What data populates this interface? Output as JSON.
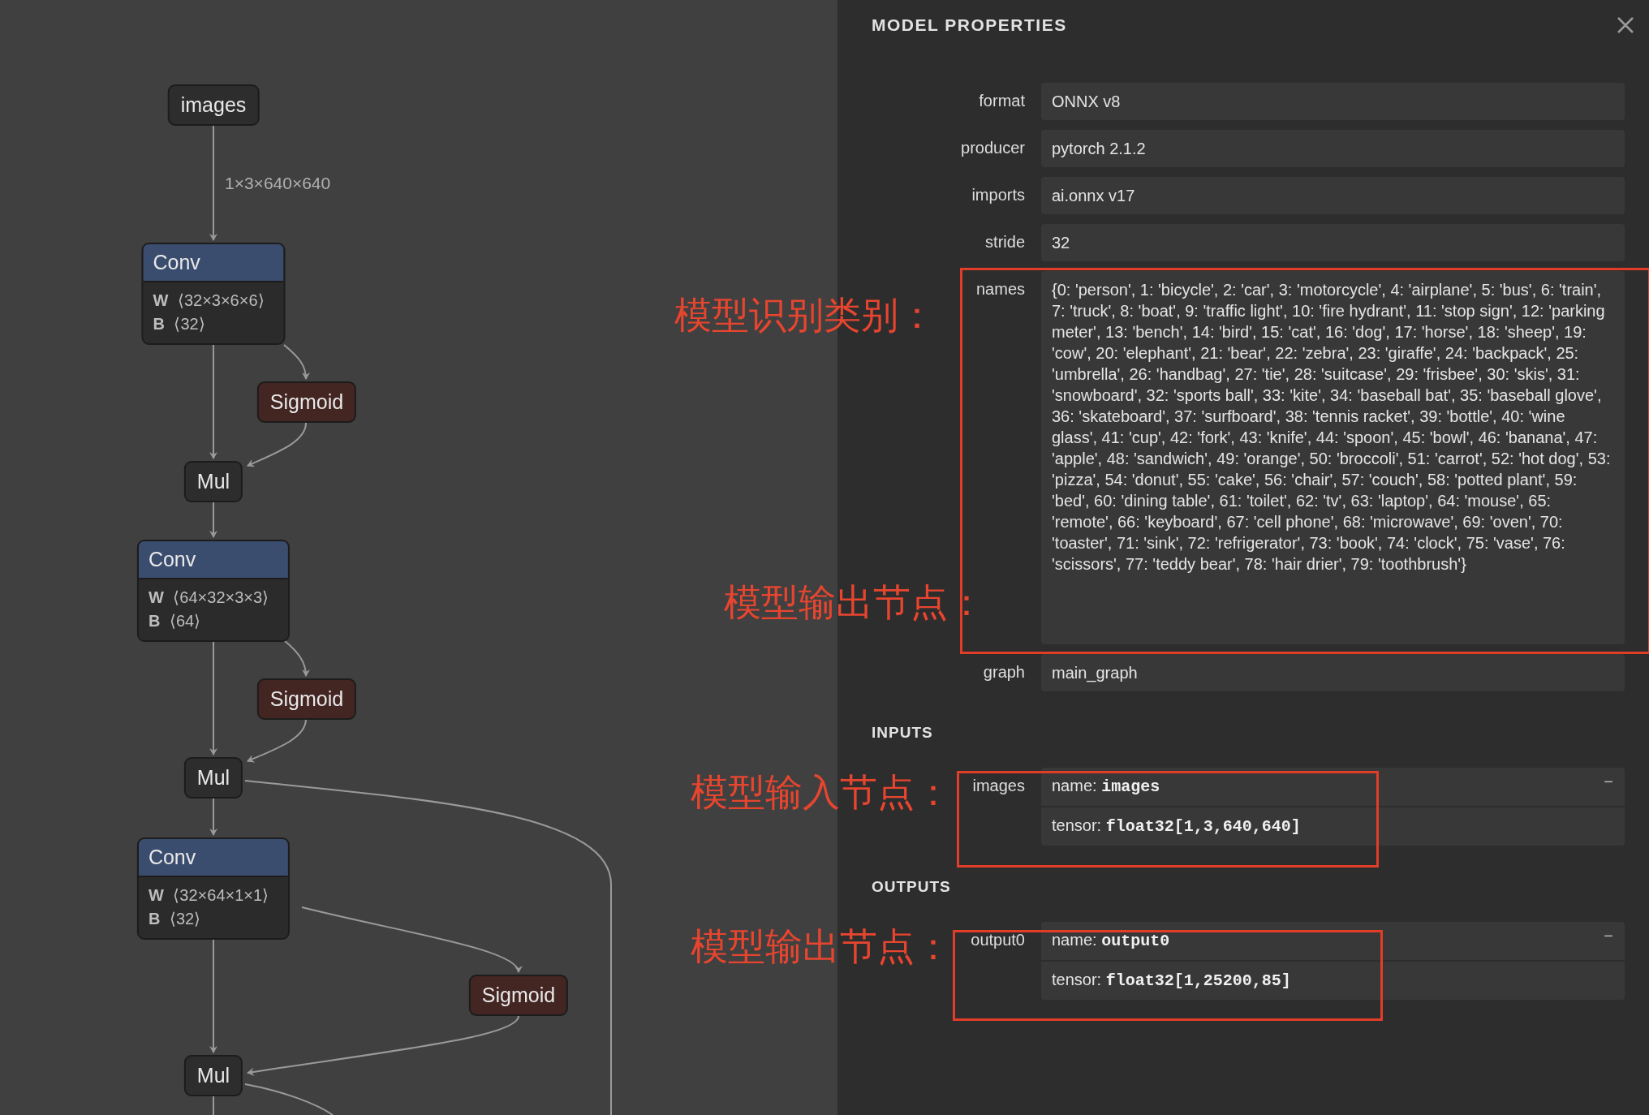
{
  "graph": {
    "nodes": [
      {
        "kind": "input",
        "label": "images"
      },
      {
        "kind": "conv",
        "label": "Conv",
        "attributes": [
          "**W** ⟨32×3×6×6⟩",
          "**B** ⟨32⟩"
        ]
      },
      {
        "kind": "sigmoid",
        "label": "Sigmoid"
      },
      {
        "kind": "mul",
        "label": "Mul"
      },
      {
        "kind": "conv",
        "label": "Conv",
        "attributes": [
          "**W** ⟨64×32×3×3⟩",
          "**B** ⟨64⟩"
        ]
      },
      {
        "kind": "sigmoid",
        "label": "Sigmoid"
      },
      {
        "kind": "mul",
        "label": "Mul"
      },
      {
        "kind": "conv",
        "label": "Conv",
        "attributes": [
          "**W** ⟨32×64×1×1⟩",
          "**B** ⟨32⟩"
        ]
      },
      {
        "kind": "sigmoid",
        "label": "Sigmoid"
      },
      {
        "kind": "mul",
        "label": "Mul"
      }
    ],
    "edge_labels": [
      "1×3×640×640"
    ]
  },
  "panel": {
    "title": "MODEL PROPERTIES",
    "properties": [
      {
        "name": "format",
        "value": "ONNX v8"
      },
      {
        "name": "producer",
        "value": "pytorch 2.1.2"
      },
      {
        "name": "imports",
        "value": "ai.onnx v17"
      },
      {
        "name": "stride",
        "value": "32"
      },
      {
        "name": "names",
        "value": "{0: 'person', 1: 'bicycle', 2: 'car', 3: 'motorcycle', 4: 'airplane', 5: 'bus', 6: 'train', 7: 'truck', 8: 'boat', 9: 'traffic light', 10: 'fire hydrant', 11: 'stop sign', 12: 'parking meter', 13: 'bench', 14: 'bird', 15: 'cat', 16: 'dog', 17: 'horse', 18: 'sheep', 19: 'cow', 20: 'elephant', 21: 'bear', 22: 'zebra', 23: 'giraffe', 24: 'backpack', 25: 'umbrella', 26: 'handbag', 27: 'tie', 28: 'suitcase', 29: 'frisbee', 30: 'skis', 31: 'snowboard', 32: 'sports ball', 33: 'kite', 34: 'baseball bat', 35: 'baseball glove', 36: 'skateboard', 37: 'surfboard', 38: 'tennis racket', 39: 'bottle', 40: 'wine glass', 41: 'cup', 42: 'fork', 43: 'knife', 44: 'spoon', 45: 'bowl', 46: 'banana', 47: 'apple', 48: 'sandwich', 49: 'orange', 50: 'broccoli', 51: 'carrot', 52: 'hot dog', 53: 'pizza', 54: 'donut', 55: 'cake', 56: 'chair', 57: 'couch', 58: 'potted plant', 59: 'bed', 60: 'dining table', 61: 'toilet', 62: 'tv', 63: 'laptop', 64: 'mouse', 65: 'remote', 66: 'keyboard', 67: 'cell phone', 68: 'microwave', 69: 'oven', 70: 'toaster', 71: 'sink', 72: 'refrigerator', 73: 'book', 74: 'clock', 75: 'vase', 76: 'scissors', 77: 'teddy bear', 78: 'hair drier', 79: 'toothbrush'}"
      },
      {
        "name": "graph",
        "value": "main_graph"
      }
    ],
    "sections": [
      {
        "title": "INPUTS",
        "items": [
          {
            "name": "images",
            "toggle": "−",
            "fields": [
              "name: **images**",
              "tensor: **float32[1,3,640,640]**"
            ]
          }
        ]
      },
      {
        "title": "OUTPUTS",
        "items": [
          {
            "name": "output0",
            "toggle": "−",
            "fields": [
              "name: **output0**",
              "tensor: **float32[1,25200,85]**"
            ]
          }
        ]
      }
    ]
  },
  "annotations": [
    {
      "text": "模型识别类别："
    },
    {
      "text": "模型输出节点："
    },
    {
      "text": "模型输入节点："
    },
    {
      "text": "模型输出节点："
    }
  ]
}
